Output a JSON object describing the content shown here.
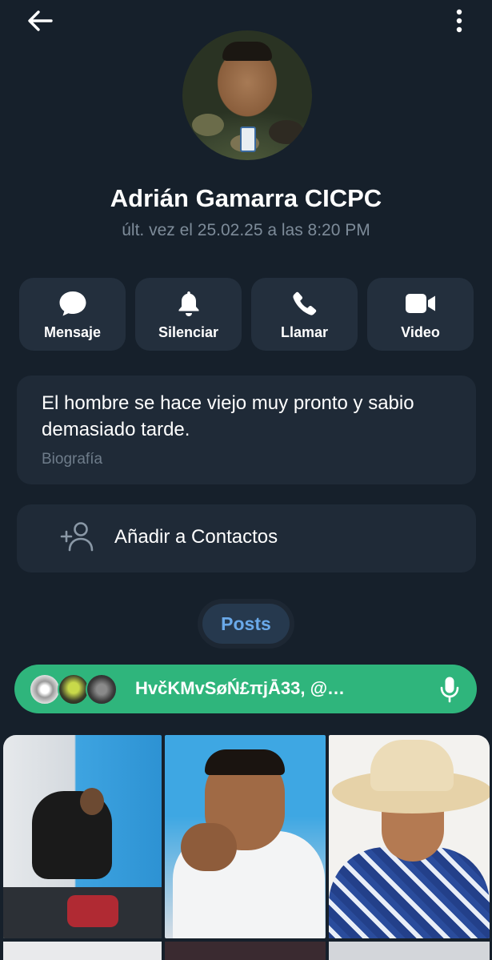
{
  "profile": {
    "name": "Adrián Gamarra CICPC",
    "last_seen": "últ. vez el 25.02.25 a las 8:20 PM"
  },
  "actions": [
    {
      "label": "Mensaje",
      "icon": "message-icon"
    },
    {
      "label": "Silenciar",
      "icon": "bell-icon"
    },
    {
      "label": "Llamar",
      "icon": "phone-icon"
    },
    {
      "label": "Video",
      "icon": "video-icon"
    }
  ],
  "bio": {
    "text": "El hombre se hace viejo muy pronto y sabio demasiado tarde.",
    "label": "Biografía"
  },
  "add_contact": {
    "label": "Añadir a Contactos",
    "icon": "add-person-icon"
  },
  "tabs": {
    "posts_label": "Posts"
  },
  "voice_chat": {
    "text": "HvčKMvSøŃ£πjĀ33, @…",
    "icon": "microphone-icon"
  },
  "colors": {
    "background": "#16202b",
    "card": "#1f2a37",
    "accent_green": "#2fb57c",
    "accent_blue": "#6aa9e9",
    "muted_text": "#7d8b99"
  }
}
